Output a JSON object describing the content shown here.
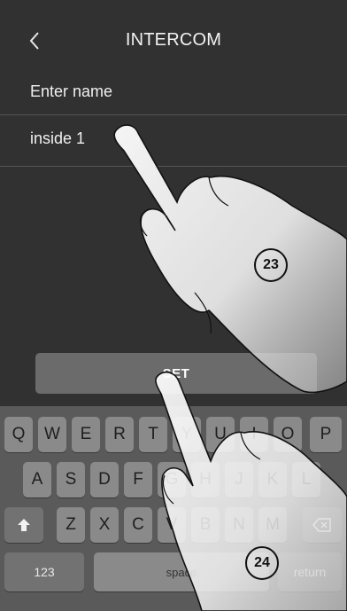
{
  "header": {
    "title": "INTERCOM",
    "back_icon": "chevron-left-icon"
  },
  "form": {
    "label": "Enter name",
    "value": "inside 1"
  },
  "set_button": {
    "label": "SET"
  },
  "keyboard": {
    "row1": [
      "Q",
      "W",
      "E",
      "R",
      "T",
      "Y",
      "U",
      "I",
      "O",
      "P"
    ],
    "row2": [
      "A",
      "S",
      "D",
      "F",
      "G",
      "H",
      "J",
      "K",
      "L"
    ],
    "row3": [
      "Z",
      "X",
      "C",
      "V",
      "B",
      "N",
      "M"
    ],
    "shift_icon": "shift-up-arrow-icon",
    "delete_icon": "backspace-icon",
    "numbers_label": "123",
    "space_label": "space",
    "return_label": "return"
  },
  "callouts": {
    "step_23": "23",
    "step_24": "24"
  },
  "colors": {
    "background": "#313131",
    "button": "#6b6b6b",
    "keyboard_bg": "#5a5a5a",
    "key": "#8a8a8a"
  }
}
